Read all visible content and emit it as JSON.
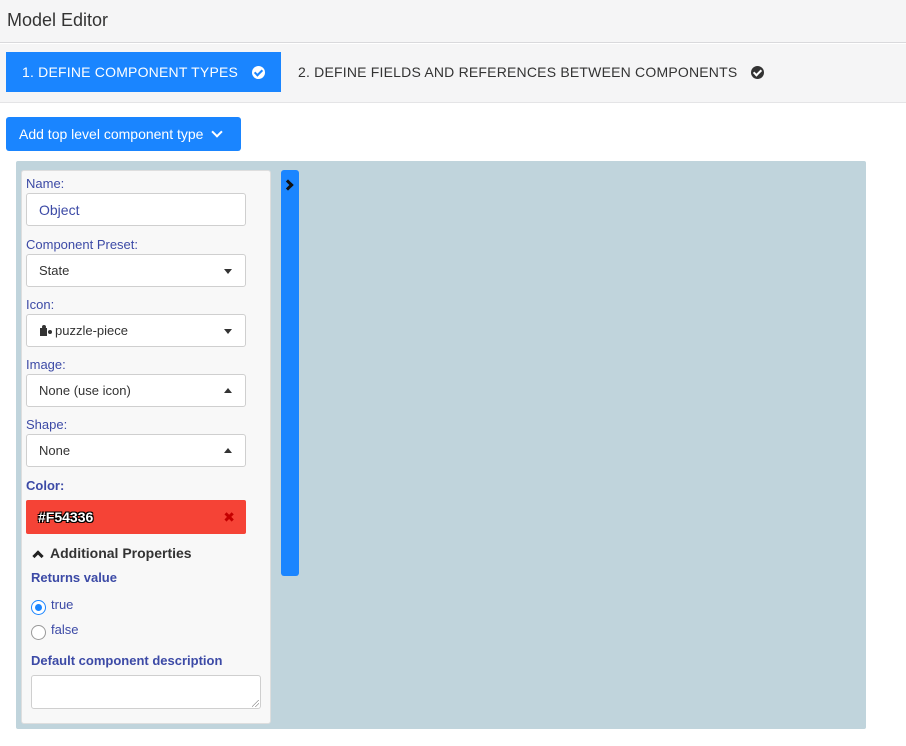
{
  "app": {
    "title": "Model Editor"
  },
  "steps": [
    {
      "label": "1. DEFINE COMPONENT TYPES",
      "active": true
    },
    {
      "label": "2. DEFINE FIELDS AND REFERENCES BETWEEN COMPONENTS",
      "active": false
    }
  ],
  "toolbar": {
    "add_button_label": "Add top level component type"
  },
  "form": {
    "name_label": "Name:",
    "name_value": "Object",
    "preset_label": "Component Preset:",
    "preset_value": "State",
    "icon_label": "Icon:",
    "icon_value": "puzzle-piece",
    "icon_name": "puzzle-piece-icon",
    "image_label": "Image:",
    "image_value": "None (use icon)",
    "shape_label": "Shape:",
    "shape_value": "None",
    "color_label": "Color:",
    "color_value": "#F54336",
    "clear_symbol": "✖",
    "additional_properties_label": "Additional Properties",
    "returns_value_label": "Returns value",
    "returns_options": [
      {
        "label": "true",
        "checked": true
      },
      {
        "label": "false",
        "checked": false
      }
    ],
    "description_label": "Default component description",
    "description_value": ""
  },
  "colors": {
    "accent": "#1a85ff",
    "canvas": "#c0d4dc",
    "label": "#3c4aa6",
    "selected_color": "#F54336"
  }
}
